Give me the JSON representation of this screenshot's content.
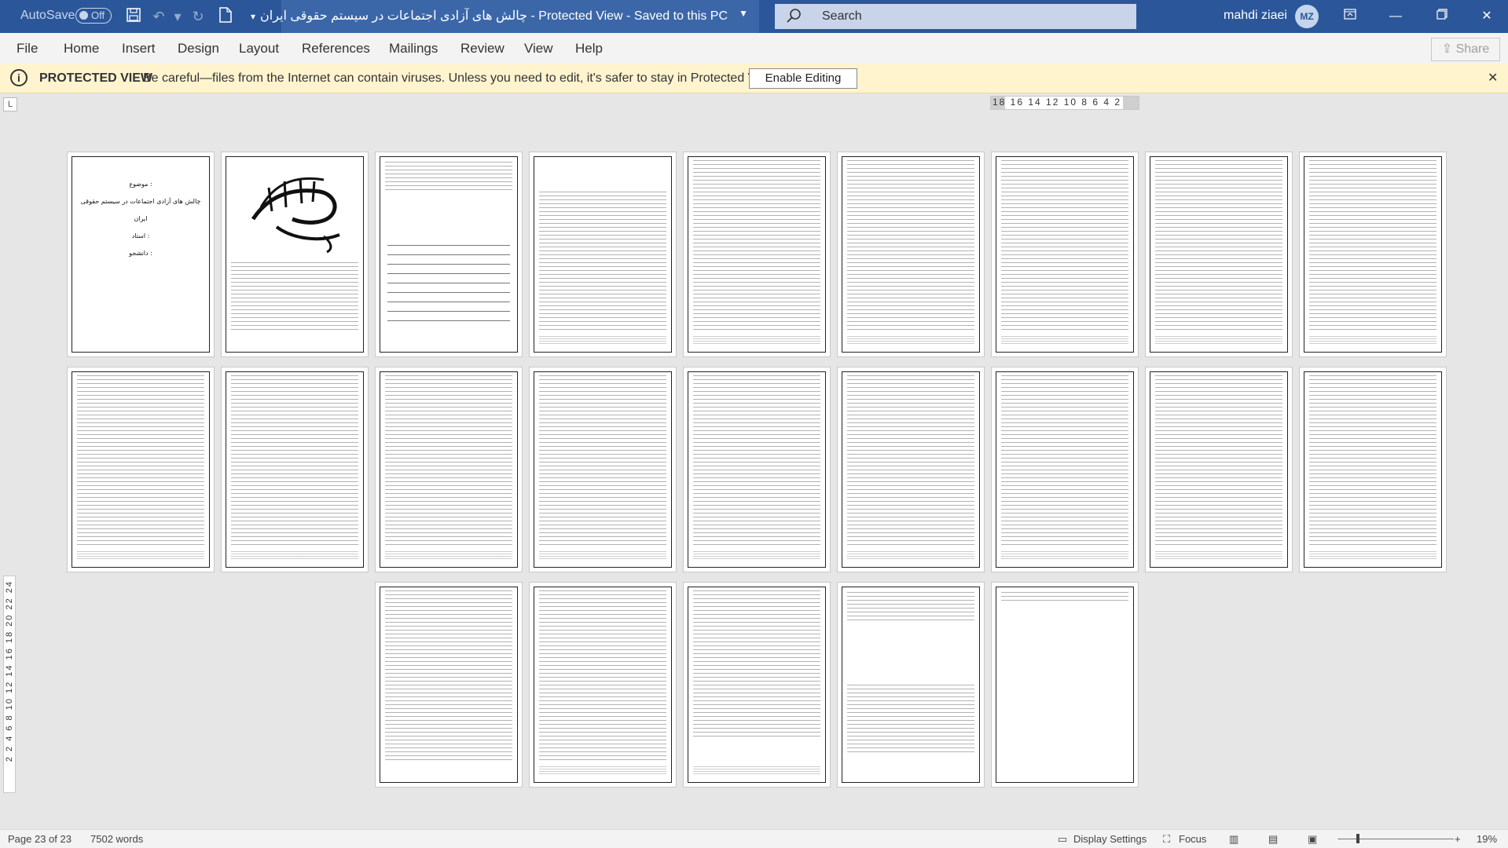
{
  "titlebar": {
    "autosave_label": "AutoSave",
    "autosave_state": "Off",
    "document_title": "چالش های آزادی اجتماعات در سیستم حقوقی ایران  -  Protected View  -  Saved to this PC",
    "search_placeholder": "Search",
    "user_name": "mahdi ziaei",
    "user_initials": "MZ"
  },
  "menu": {
    "items": [
      "File",
      "Home",
      "Insert",
      "Design",
      "Layout",
      "References",
      "Mailings",
      "Review",
      "View",
      "Help"
    ],
    "share_label": "Share"
  },
  "protected_view": {
    "label": "PROTECTED VIEW",
    "message": "Be careful—files from the Internet can contain viruses. Unless you need to edit, it's safer to stay in Protected View.",
    "button_label": "Enable Editing"
  },
  "ruler": {
    "horizontal": "18 16 14 12 10  8  6  4  2",
    "vertical": "2 2 4 6 8 10 12 14 16 18 20 22 24"
  },
  "cover_page": {
    "line1": "موضوع :",
    "line2": "چالش های آزادی اجتماعات در سیستم حقوقی ایران",
    "line3": "استاد :",
    "line4": "دانشجو :"
  },
  "status": {
    "page": "Page 23 of 23",
    "words": "7502 words",
    "display_settings": "Display Settings",
    "focus": "Focus",
    "zoom": "19%"
  },
  "colors": {
    "title_bar": "#2b579a",
    "protected_bar": "#fff4ce"
  }
}
